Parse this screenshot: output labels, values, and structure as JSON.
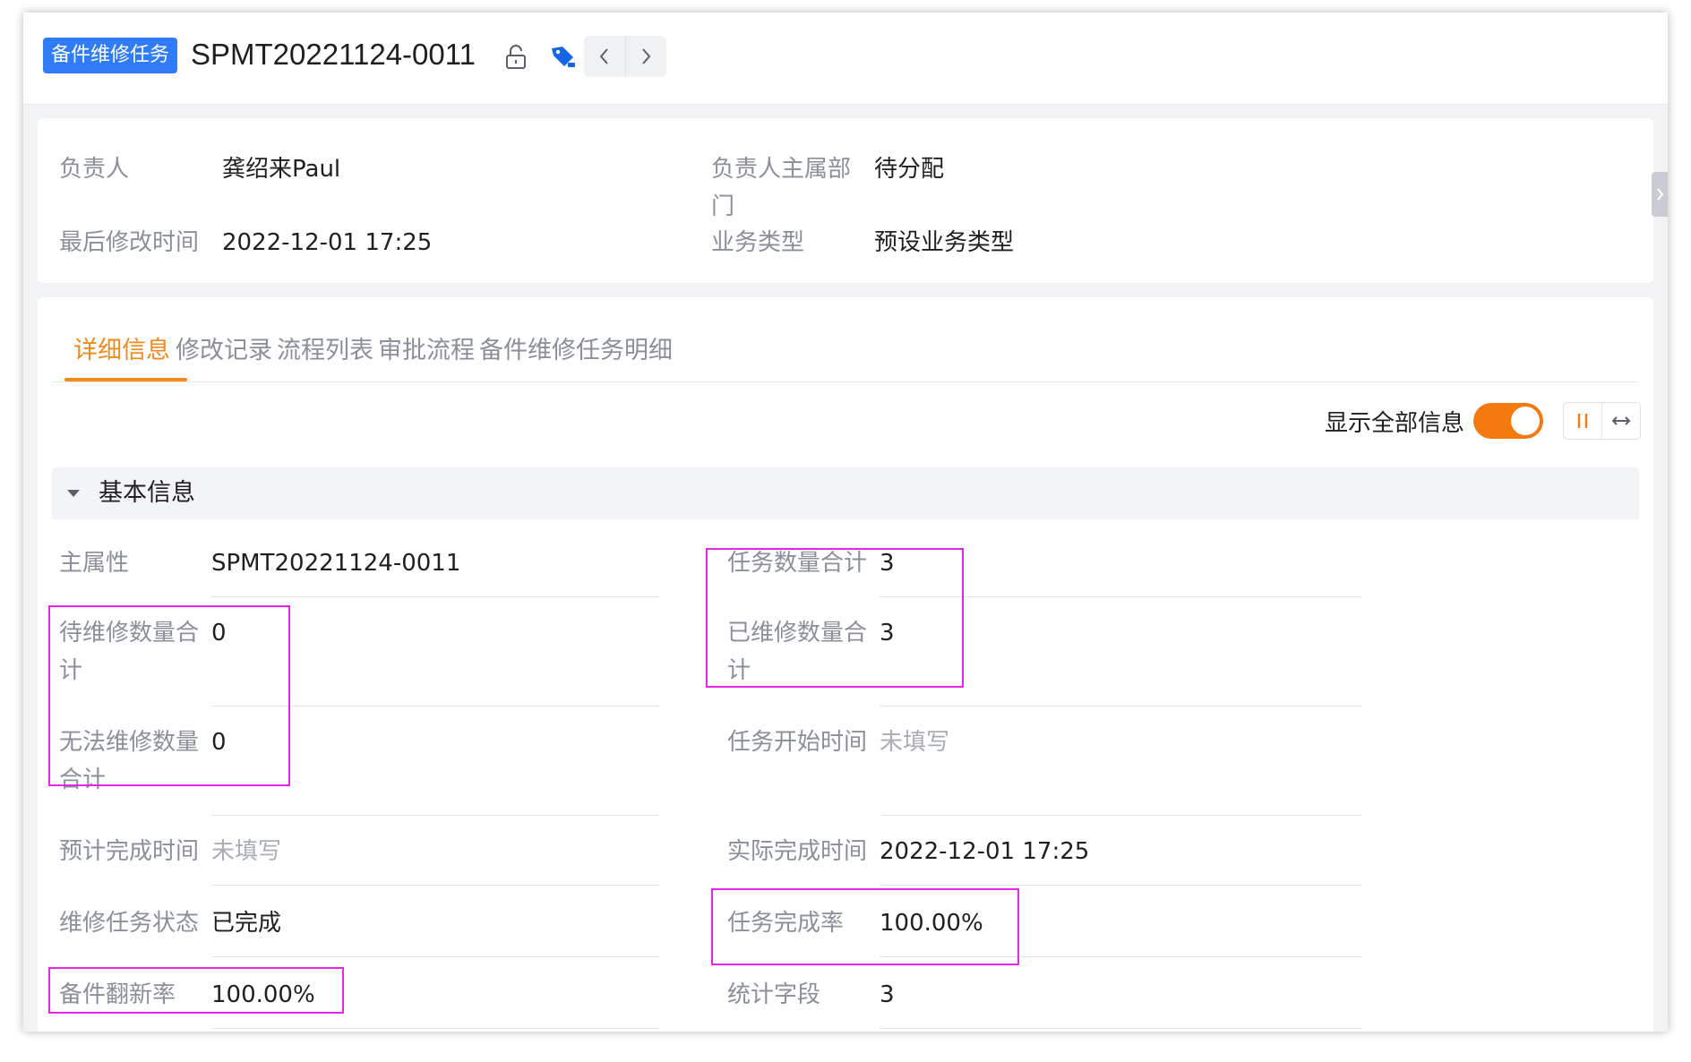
{
  "header": {
    "object_tag": "备件维修任务",
    "record_id": "SPMT20221124-0011",
    "icons": [
      "lock-icon",
      "tag-icon",
      "chevron-left-icon",
      "chevron-right-icon"
    ]
  },
  "summary": {
    "owner_label": "负责人",
    "owner_value": "龚绍来Paul",
    "dept_label_line1": "负责人主属部",
    "dept_label_line2": "门",
    "dept_value": "待分配",
    "modified_label": "最后修改时间",
    "modified_value": "2022-12-01 17:25",
    "biz_type_label": "业务类型",
    "biz_type_value": "预设业务类型"
  },
  "tabs": [
    {
      "label": "详细信息",
      "active": true
    },
    {
      "label": "修改记录",
      "active": false
    },
    {
      "label": "流程列表",
      "active": false
    },
    {
      "label": "审批流程",
      "active": false
    },
    {
      "label": "备件维修任务明细",
      "active": false
    }
  ],
  "toggle": {
    "label": "显示全部信息",
    "on": true
  },
  "section": {
    "title": "基本信息"
  },
  "fields_left": [
    {
      "label_lines": [
        "主属性"
      ],
      "value": "SPMT20221124-0011",
      "muted": false
    },
    {
      "label_lines": [
        "待维修数量合",
        "计"
      ],
      "value": "0",
      "muted": false
    },
    {
      "label_lines": [
        "无法维修数量",
        "合计"
      ],
      "value": "0",
      "muted": false
    },
    {
      "label_lines": [
        "预计完成时间"
      ],
      "value": "未填写",
      "muted": true
    },
    {
      "label_lines": [
        "维修任务状态"
      ],
      "value": "已完成",
      "muted": false
    },
    {
      "label_lines": [
        "备件翻新率"
      ],
      "value": "100.00%",
      "muted": false
    }
  ],
  "fields_right": [
    {
      "label_lines": [
        "任务数量合计"
      ],
      "value": "3",
      "muted": false
    },
    {
      "label_lines": [
        "已维修数量合",
        "计"
      ],
      "value": "3",
      "muted": false
    },
    {
      "label_lines": [
        "任务开始时间"
      ],
      "value": "未填写",
      "muted": true
    },
    {
      "label_lines": [
        "实际完成时间"
      ],
      "value": "2022-12-01 17:25",
      "muted": false
    },
    {
      "label_lines": [
        "任务完成率"
      ],
      "value": "100.00%",
      "muted": false
    },
    {
      "label_lines": [
        "统计字段"
      ],
      "value": "3",
      "muted": false
    }
  ],
  "colors": {
    "accent": "#f08a1c",
    "toggle_on": "#f47a10",
    "tag_blue": "#2f7cf6",
    "highlight": "#e625e6"
  }
}
